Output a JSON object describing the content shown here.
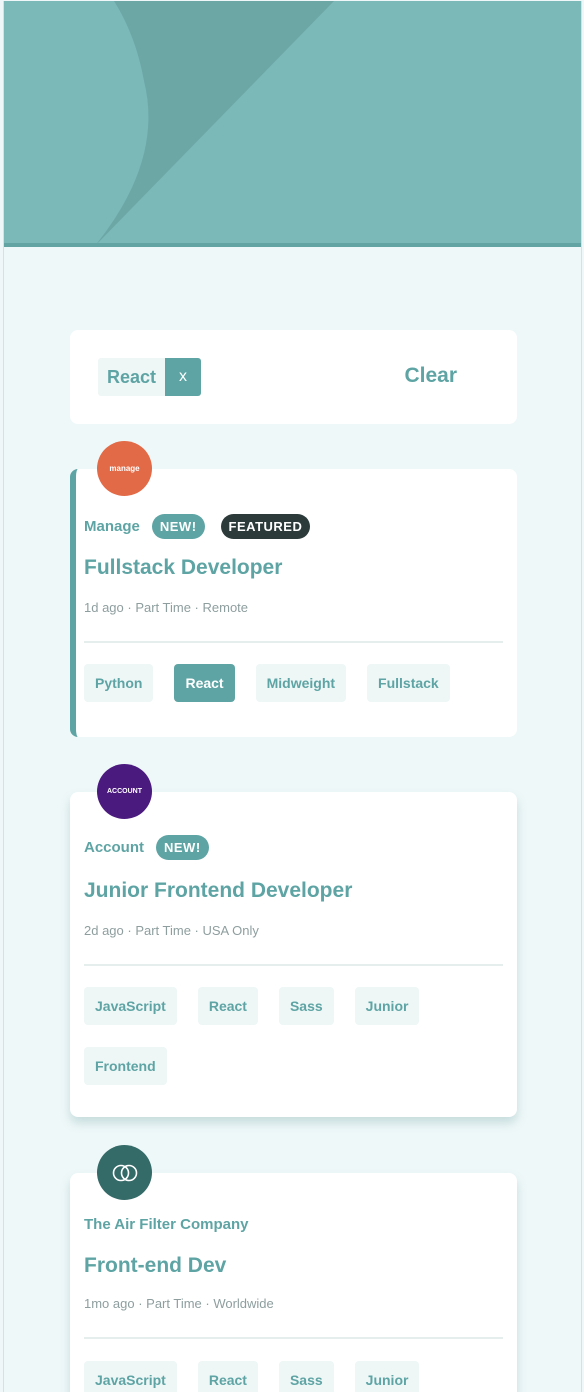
{
  "filter": {
    "active_tags": [
      "React"
    ],
    "remove_label": "x",
    "clear_label": "Clear"
  },
  "colors": {
    "primary": "#5ea4a4",
    "header": "#7bb8b8",
    "badge_dark": "#2c3a3a",
    "logo_manage": "#e26a47",
    "logo_account": "#4b1a7f",
    "logo_air": "#346a68"
  },
  "jobs": [
    {
      "company": "Manage",
      "logo_text": "manage",
      "logo_icon": "manage-logo",
      "badges": {
        "new": "NEW!",
        "featured": "FEATURED"
      },
      "position": "Fullstack Developer",
      "meta": "1d ago · Part Time · Remote",
      "tags": [
        "Python",
        "React",
        "Midweight",
        "Fullstack"
      ]
    },
    {
      "company": "Account",
      "logo_text": "ACCOUNT",
      "logo_icon": "account-logo",
      "badges": {
        "new": "NEW!"
      },
      "position": "Junior Frontend Developer",
      "meta": "2d ago · Part Time · USA Only",
      "tags": [
        "JavaScript",
        "React",
        "Sass",
        "Junior",
        "Frontend"
      ]
    },
    {
      "company": "The Air Filter Company",
      "logo_icon": "air-filter-logo",
      "position": "Front-end Dev",
      "meta": "1mo ago · Part Time · Worldwide",
      "tags": [
        "JavaScript",
        "React",
        "Sass",
        "Junior"
      ]
    }
  ]
}
